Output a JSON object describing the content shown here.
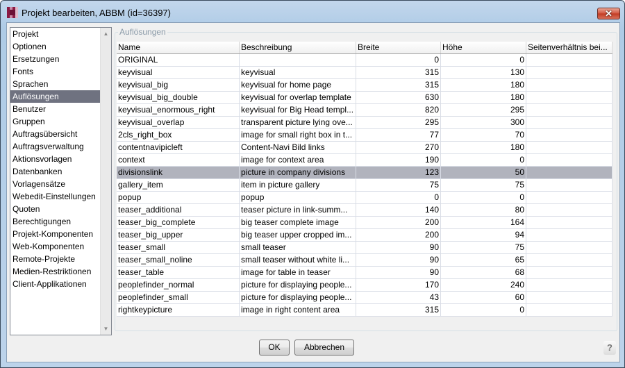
{
  "window": {
    "title": "Projekt bearbeiten, ABBM (id=36397)",
    "close": "✕"
  },
  "sidebar": {
    "selected": "Auflösungen",
    "items": [
      "Projekt",
      "Optionen",
      "Ersetzungen",
      "Fonts",
      "Sprachen",
      "Auflösungen",
      "Benutzer",
      "Gruppen",
      "Auftragsübersicht",
      "Auftragsverwaltung",
      "Aktionsvorlagen",
      "Datenbanken",
      "Vorlagensätze",
      "Webedit-Einstellungen",
      "Quoten",
      "Berechtigungen",
      "Projekt-Komponenten",
      "Web-Komponenten",
      "Remote-Projekte",
      "Medien-Restriktionen",
      "Client-Applikationen"
    ]
  },
  "group": {
    "legend": "Auflösungen"
  },
  "table": {
    "columns": [
      "Name",
      "Beschreibung",
      "Breite",
      "Höhe",
      "Seitenverhältnis bei..."
    ],
    "selected_row": "divisionslink",
    "rows": [
      [
        "ORIGINAL",
        "",
        "0",
        "0",
        ""
      ],
      [
        "keyvisual",
        "keyvisual",
        "315",
        "130",
        ""
      ],
      [
        "keyvisual_big",
        "keyvisual for home page",
        "315",
        "180",
        ""
      ],
      [
        "keyvisual_big_double",
        "keyvisual for overlap template",
        "630",
        "180",
        ""
      ],
      [
        "keyvisual_enormous_right",
        "keyvisual for Big Head templ...",
        "820",
        "295",
        ""
      ],
      [
        "keyvisual_overlap",
        "transparent picture lying ove...",
        "295",
        "300",
        ""
      ],
      [
        "2cls_right_box",
        "image for small right box in t...",
        "77",
        "70",
        ""
      ],
      [
        "contentnavipicleft",
        "Content-Navi Bild links",
        "270",
        "180",
        ""
      ],
      [
        "context",
        "image for context area",
        "190",
        "0",
        ""
      ],
      [
        "divisionslink",
        "picture in company divisions",
        "123",
        "50",
        ""
      ],
      [
        "gallery_item",
        "item in picture gallery",
        "75",
        "75",
        ""
      ],
      [
        "popup",
        "popup",
        "0",
        "0",
        ""
      ],
      [
        "teaser_additional",
        "teaser picture in link-summ...",
        "140",
        "80",
        ""
      ],
      [
        "teaser_big_complete",
        "big teaser complete image",
        "200",
        "164",
        ""
      ],
      [
        "teaser_big_upper",
        "big teaser upper cropped im...",
        "200",
        "94",
        ""
      ],
      [
        "teaser_small",
        "small teaser",
        "90",
        "75",
        ""
      ],
      [
        "teaser_small_noline",
        "small teaser without white li...",
        "90",
        "65",
        ""
      ],
      [
        "teaser_table",
        "image for table in teaser",
        "90",
        "68",
        ""
      ],
      [
        "peoplefinder_normal",
        "picture for displaying people...",
        "170",
        "240",
        ""
      ],
      [
        "peoplefinder_small",
        "picture for displaying people...",
        "43",
        "60",
        ""
      ],
      [
        "rightkeypicture",
        "image in right content area",
        "315",
        "0",
        ""
      ]
    ]
  },
  "buttons": {
    "ok": "OK",
    "cancel": "Abbrechen",
    "help": "?"
  },
  "icons": {
    "scroll_up": "▲",
    "scroll_down": "▼"
  },
  "colors": {
    "selection_sidebar": "#6f7280",
    "selection_row": "#b1b3bd"
  }
}
